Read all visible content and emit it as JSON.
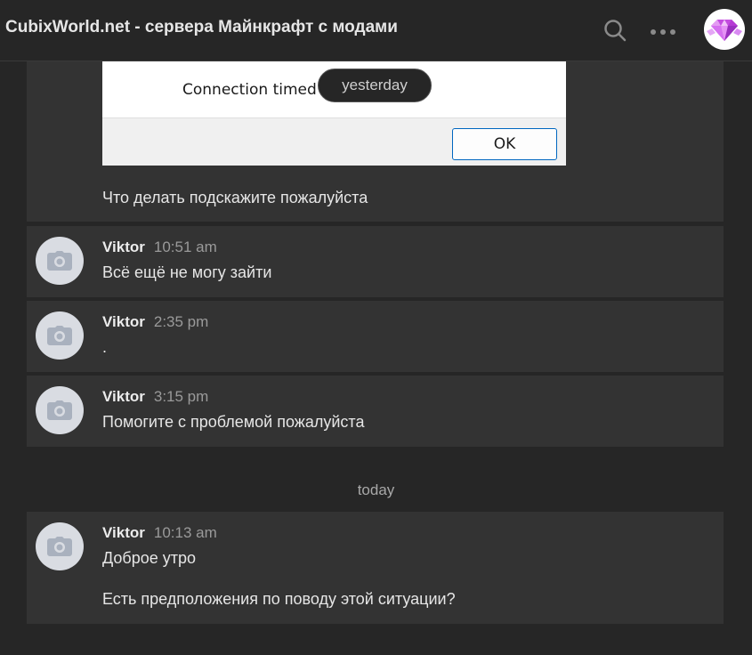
{
  "header": {
    "title": "CubixWorld.net - сервера Майнкрафт с модами",
    "search_icon": "search-icon",
    "more_icon": "more-horizontal-icon",
    "avatar": "diamond-logo"
  },
  "first_message": {
    "attachment": {
      "dialog_text": "Connection timed",
      "ok_label": "OK"
    },
    "date_pill": "yesterday",
    "text": "Что делать подскажите пожалуйста"
  },
  "messages": [
    {
      "author": "Viktor",
      "time": "10:51 am",
      "lines": [
        "Всё ещё не могу зайти"
      ]
    },
    {
      "author": "Viktor",
      "time": "2:35 pm",
      "lines": [
        "."
      ]
    },
    {
      "author": "Viktor",
      "time": "3:15 pm",
      "lines": [
        "Помогите с проблемой пожалуйста"
      ]
    },
    {
      "author": "Viktor",
      "time": "10:13 am",
      "lines": [
        "Доброе утро",
        "Есть предположения по поводу этой ситуации?"
      ]
    }
  ],
  "divider": "today",
  "colors": {
    "background": "#262626",
    "card": "#333333",
    "avatar_placeholder": "#d9dce2",
    "ok_border": "#0067c0"
  }
}
